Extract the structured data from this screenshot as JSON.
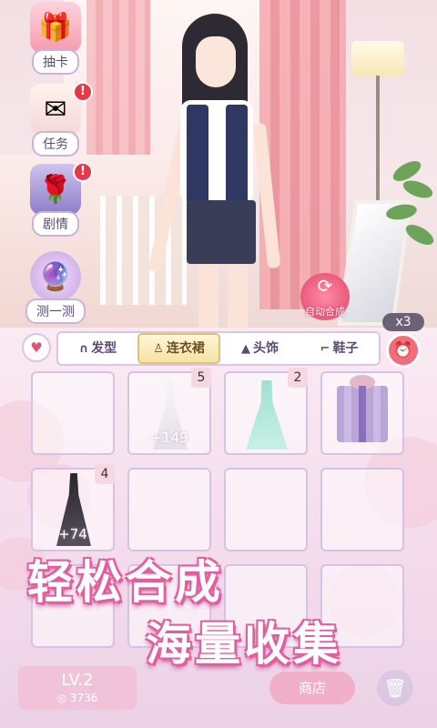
{
  "menu": {
    "draw": {
      "label": "抽卡",
      "icon": "gift-box-icon"
    },
    "task": {
      "label": "任务",
      "icon": "letter-icon",
      "badge": "!"
    },
    "story": {
      "label": "剧情",
      "icon": "rose-book-icon",
      "badge": "!"
    },
    "test": {
      "label": "测一测",
      "icon": "crystal-ball-icon"
    }
  },
  "auto_merge": {
    "label": "自动合成",
    "icon": "refresh-icon"
  },
  "multiplier": "x3",
  "tabs": [
    {
      "label": "发型",
      "icon": "hair-icon",
      "active": false
    },
    {
      "label": "连衣裙",
      "icon": "dress-icon",
      "active": true
    },
    {
      "label": "头饰",
      "icon": "hat-icon",
      "active": false
    },
    {
      "label": "鞋子",
      "icon": "heel-shoe-icon",
      "active": false
    }
  ],
  "items": [
    {
      "type": "white-wedding-dress",
      "count": "5",
      "bonus": "+149"
    },
    {
      "type": "mint-green-dress",
      "count": "2",
      "bonus": ""
    },
    {
      "type": "purple-gift-box",
      "count": "",
      "bonus": ""
    },
    {
      "type": "black-gown",
      "count": "4",
      "bonus": "+74"
    }
  ],
  "promo": {
    "line1": "轻松合成",
    "line2": "海量收集"
  },
  "footer": {
    "level": "LV.2",
    "coins": "3736",
    "shop": "商店"
  },
  "colors": {
    "accent": "#e05fa0",
    "panel": "#f3dbeb",
    "badge": "#e5394b"
  }
}
